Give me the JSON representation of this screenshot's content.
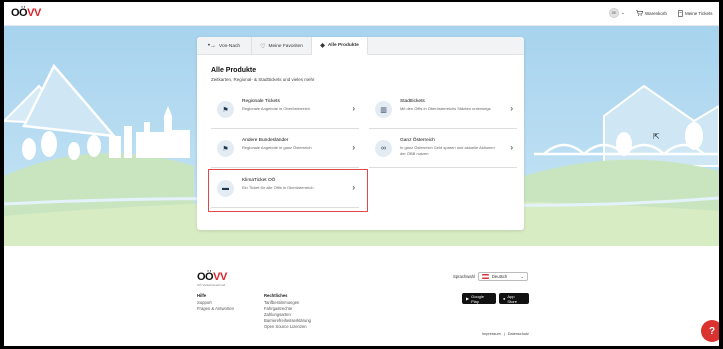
{
  "header": {
    "logo": {
      "main": "OÖ",
      "accent": "VV"
    },
    "lang_badge": "DE",
    "cart_label": "Warenkorb",
    "tickets_label": "Meine Tickets",
    "icons": {
      "cart": "cart-icon",
      "tickets": "ticket-icon",
      "lang_chevron": "chevron-down-icon"
    }
  },
  "tabs": [
    {
      "label": "Von-Nach",
      "icon": "route-icon",
      "glyph": "•→",
      "active": false
    },
    {
      "label": "Meine Favoriten",
      "icon": "heart-icon",
      "glyph": "♡",
      "active": false
    },
    {
      "label": "Alle Produkte",
      "icon": "tag-icon",
      "glyph": "◆",
      "active": true
    }
  ],
  "main": {
    "title": "Alle Produkte",
    "subtitle": "Zeitkarten, Regional- & Stadttickets und vieles mehr",
    "products": [
      {
        "title": "Regionale Tickets",
        "desc": "Regionale Angebote in Oberösterreich",
        "icon": "signpost-icon",
        "glyph": "⚑"
      },
      {
        "title": "Stadttickets",
        "desc": "Mit den Öffis in Oberösterreichs Städten unterwegs",
        "icon": "city-icon",
        "glyph": "▥"
      },
      {
        "title": "Andere Bundesländer",
        "desc": "Regionale Angebote in ganz Österreich",
        "icon": "signpost-icon",
        "glyph": "⚑"
      },
      {
        "title": "Ganz Österreich",
        "desc": "In ganz Österreich Geld sparen und aktuelle Aktionen der ÖBB nutzen",
        "icon": "train-icon",
        "glyph": "∞"
      },
      {
        "title": "KlimaTicket OÖ",
        "desc": "Ein Ticket für alle Öffis in Oberösterreich",
        "icon": "card-icon",
        "glyph": "▬"
      }
    ],
    "chevron": "›"
  },
  "footer": {
    "logo": {
      "main": "OÖ",
      "accent": "VV"
    },
    "logo_sub": "OÖ Verkehrsverbund",
    "help": {
      "heading": "Hilfe",
      "links": [
        "Support",
        "Fragen & Antworten"
      ]
    },
    "legal": {
      "heading": "Rechtliches",
      "links": [
        "Tarifbestimmungen",
        "Fahrgastrechte",
        "Zahlungsarten",
        "Barrierefreiheitserklärung",
        "Open Source Lizenzen"
      ]
    },
    "language_label": "Sprachwahl",
    "language_value": "Deutsch",
    "google_play": "Google Play",
    "app_store": "App Store",
    "impressum": "Impressum",
    "separator": "|",
    "datenschutz": "Datenschutz"
  },
  "help_button": "?",
  "colors": {
    "accent": "#d9252a",
    "highlight": "#e0484d",
    "sky": "#b9ddf2",
    "grass": "#d8ecc4"
  }
}
